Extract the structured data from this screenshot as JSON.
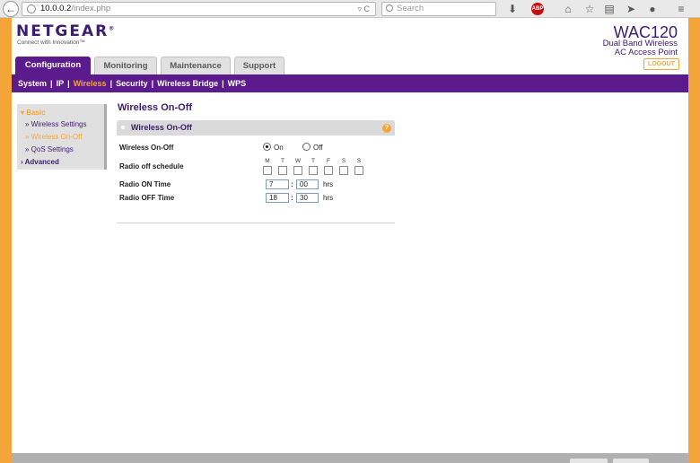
{
  "browser": {
    "url_host": "10.0.0.2",
    "url_path": "/index.php",
    "url_tools": "▿ C",
    "search_placeholder": "Search",
    "back_glyph": "←"
  },
  "header": {
    "logo": "NETGEAR",
    "logo_mark": "®",
    "tagline": "Connect with Innovation™",
    "model": "WAC120",
    "model_line1": "Dual Band Wireless",
    "model_line2": "AC Access Point",
    "logout": "LOGOUT"
  },
  "tabs": [
    {
      "label": "Configuration",
      "active": true
    },
    {
      "label": "Monitoring",
      "active": false
    },
    {
      "label": "Maintenance",
      "active": false
    },
    {
      "label": "Support",
      "active": false
    }
  ],
  "subnav": [
    "System",
    "IP",
    "Wireless",
    "Security",
    "Wireless Bridge",
    "WPS"
  ],
  "subnav_current": "Wireless",
  "leftmenu": {
    "basic": "Basic",
    "items": [
      "Wireless Settings",
      "Wireless On-Off",
      "QoS Settings"
    ],
    "selected": "Wireless On-Off",
    "advanced": "Advanced"
  },
  "main": {
    "title": "Wireless On-Off",
    "panel_title": "Wireless On-Off",
    "help": "?",
    "on_off_label": "Wireless On-Off",
    "on": "On",
    "off": "Off",
    "selected": "On",
    "schedule_label": "Radio off schedule",
    "days": [
      "M",
      "T",
      "W",
      "T",
      "F",
      "S",
      "S"
    ],
    "radio_on_label": "Radio ON Time",
    "radio_on_hours": "7",
    "radio_on_minutes": "00",
    "radio_off_label": "Radio OFF Time",
    "radio_off_hours": "18",
    "radio_off_minutes": "30",
    "hrs": "hrs",
    "colon": ":"
  },
  "colors": {
    "brand_purple": "#5b1b8c",
    "accent_orange": "#f4a53a"
  }
}
